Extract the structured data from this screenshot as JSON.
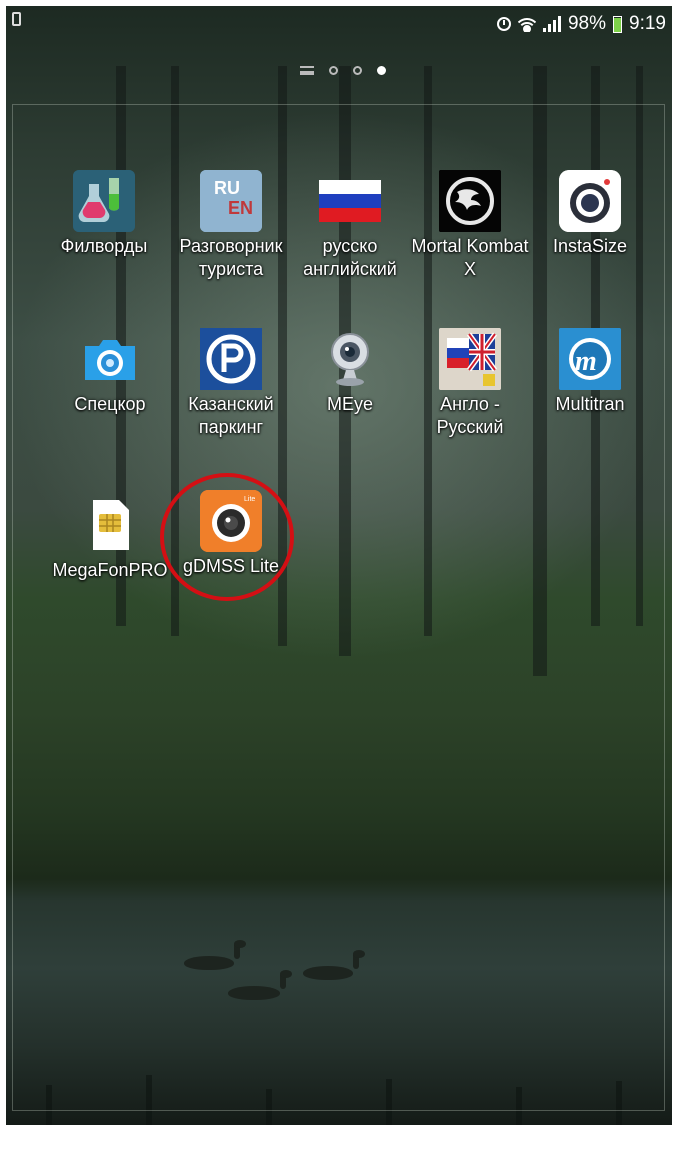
{
  "status_bar": {
    "battery_percent": "98%",
    "time": "9:19",
    "battery_level": 0.98,
    "icons": [
      "sim-icon",
      "alarm-icon",
      "wifi-icon",
      "signal-icon",
      "battery-icon"
    ]
  },
  "page_indicator": {
    "pages": 3,
    "active": 3
  },
  "apps": [
    {
      "label": "Филворды",
      "icon": "flasks-icon"
    },
    {
      "label": "Разговорник туриста",
      "icon": "ru-en-phrasebook-icon",
      "icon_text": "RU EN"
    },
    {
      "label": "русско английский",
      "icon": "russian-flag-icon"
    },
    {
      "label": "Mortal Kombat X",
      "icon": "dragon-logo-icon"
    },
    {
      "label": "InstaSize",
      "icon": "camera-lens-icon"
    },
    {
      "label": "Спецкор",
      "icon": "camera-icon"
    },
    {
      "label": "Казанский паркинг",
      "icon": "parking-p-icon"
    },
    {
      "label": "MEye",
      "icon": "webcam-icon"
    },
    {
      "label": "Англо - Русский",
      "icon": "uk-russia-dictionary-icon"
    },
    {
      "label": "Multitran",
      "icon": "multitran-logo-icon",
      "icon_text": "m"
    },
    {
      "label": "MegaFonPRO",
      "icon": "sim-card-icon"
    },
    {
      "label": "gDMSS Lite",
      "icon": "orange-camera-icon",
      "icon_text": "Lite"
    }
  ],
  "colors": {
    "highlight_ring": "#d40f14",
    "orange_app": "#f07f2a",
    "parking_blue": "#1c4f9c",
    "multitran_blue": "#2a8fd1"
  }
}
